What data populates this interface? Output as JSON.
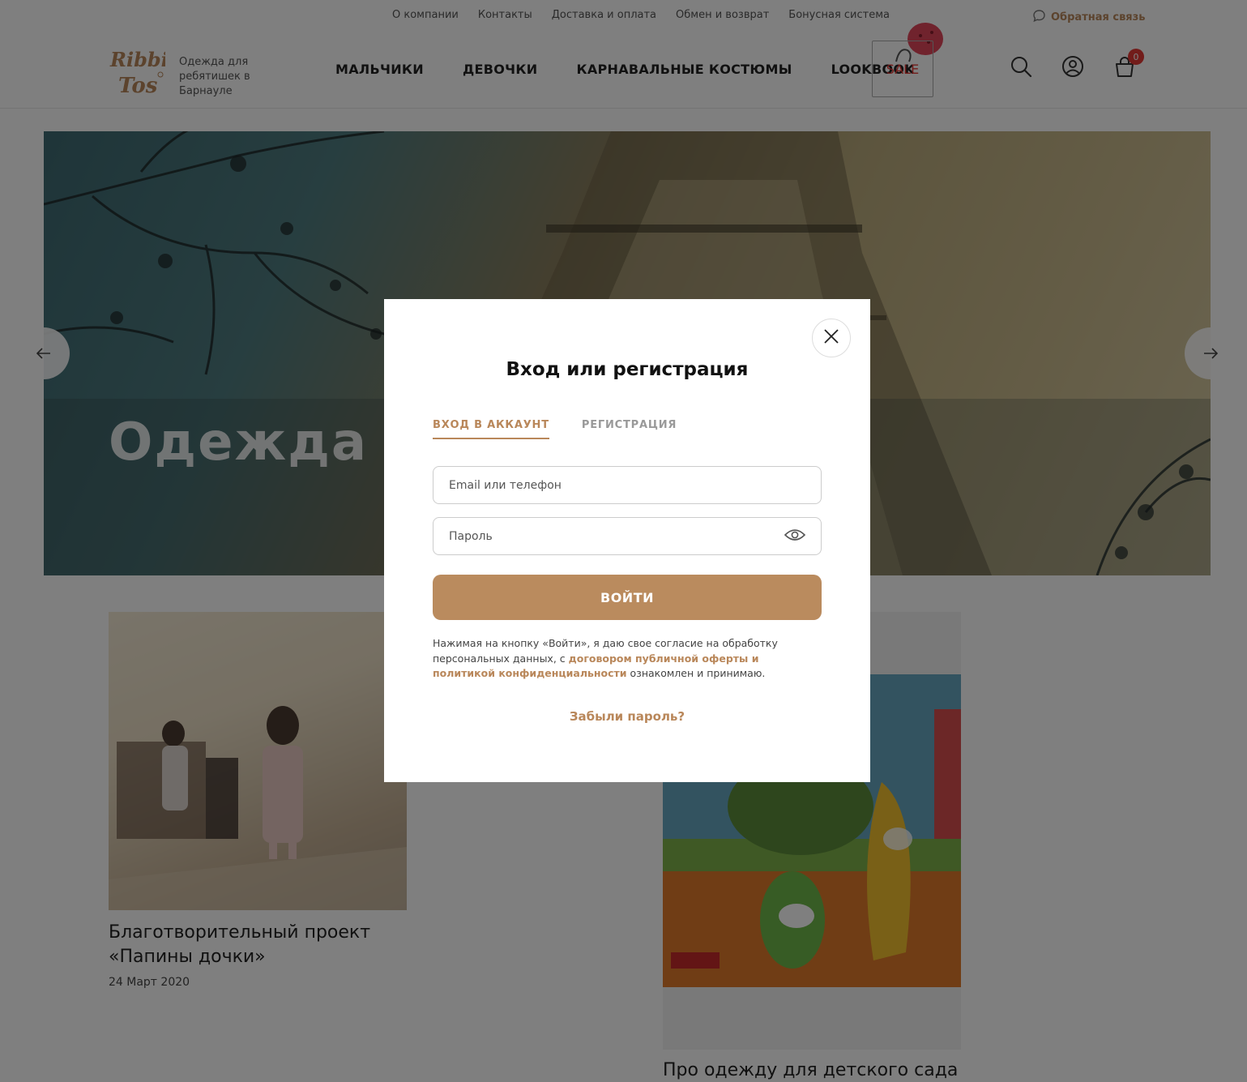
{
  "topnav": {
    "items": [
      "О компании",
      "Контакты",
      "Доставка и оплата",
      "Обмен и возврат",
      "Бонусная система"
    ],
    "feedback": "Обратная связь"
  },
  "header": {
    "logo_text": "Ribbi Tos",
    "tagline": "Одежда для ребятишек в Барнауле",
    "nav": [
      "МАЛЬЧИКИ",
      "ДЕВОЧКИ",
      "КАРНАВАЛЬНЫЕ КОСТЮМЫ",
      "LOOKBOOK"
    ],
    "sale": "SALE",
    "cart_count": "0"
  },
  "hero": {
    "title": "Одежда для школы"
  },
  "blog": {
    "card1": {
      "title": "Благотворительный проект «Папины дочки»",
      "date": "24 Март 2020"
    },
    "card2": {
      "title": "Про одежду для детского сада"
    }
  },
  "modal": {
    "title": "Вход или регистрация",
    "tab_login": "ВХОД В АККАУНТ",
    "tab_register": "РЕГИСТРАЦИЯ",
    "email_placeholder": "Email или телефон",
    "password_placeholder": "Пароль",
    "submit": "ВОЙТИ",
    "consent_prefix": "Нажимая на кнопку «Войти», я даю свое согласие на обработку персональных данных, с ",
    "consent_link": "договором публичной оферты и политикой конфиденциальности",
    "consent_suffix": " ознакомлен и принимаю.",
    "forgot": "Забыли пароль?"
  },
  "colors": {
    "accent": "#b9875a",
    "sale": "#e53935",
    "button": "#ba8b5e"
  }
}
